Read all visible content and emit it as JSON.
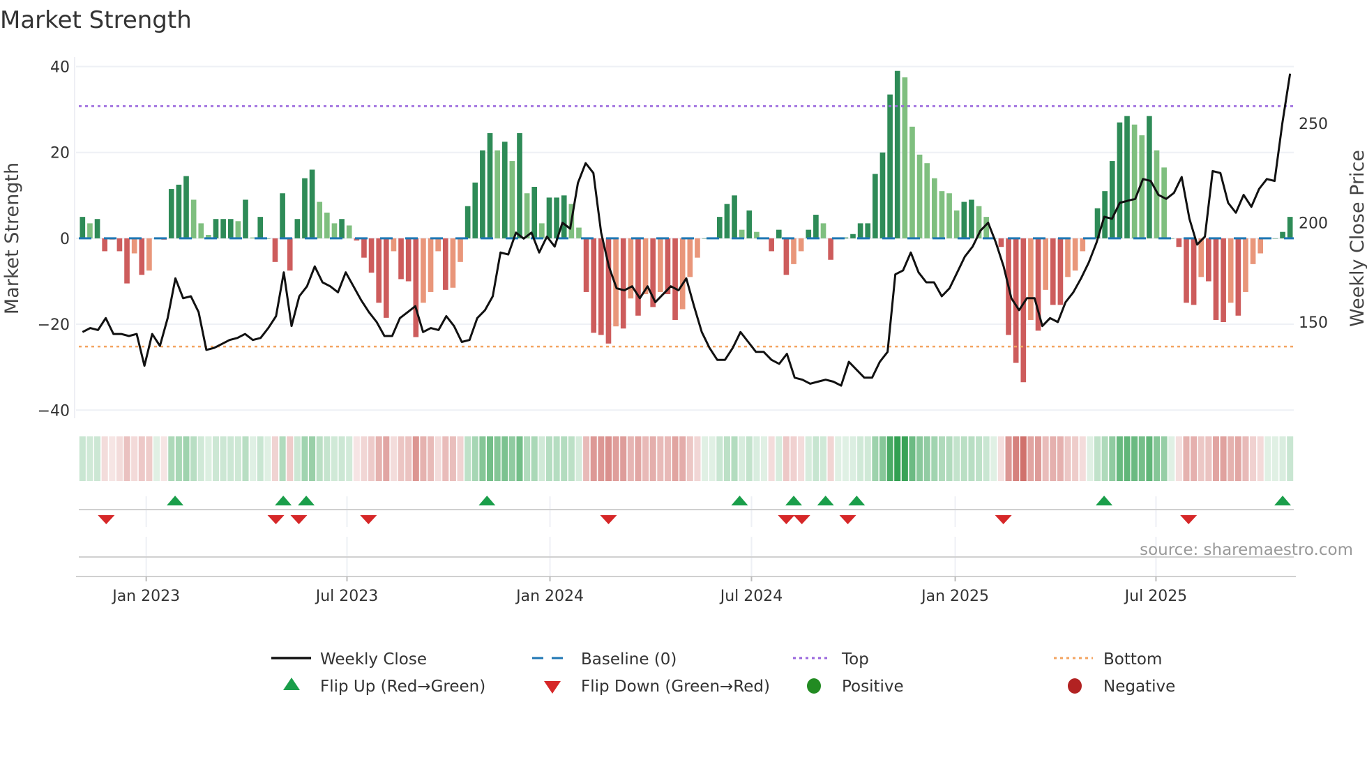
{
  "chart_data": {
    "type": "bar",
    "title": "Market Strength",
    "ylabel": "Market Strength",
    "y2label": "Weekly Close Price",
    "ylim": [
      -41.9,
      42.2
    ],
    "y2lim": [
      101.6,
      283.3
    ],
    "yticks": [
      40,
      20,
      0,
      -20,
      -40
    ],
    "yticklabels": [
      "40",
      "20",
      "0",
      "−20",
      "−40"
    ],
    "y2ticks": [
      150,
      200,
      250
    ],
    "y2ticklabels": [
      "150",
      "200",
      "250"
    ],
    "xticks": [
      {
        "label": "Jan 2023",
        "week_index": 8.6
      },
      {
        "label": "Jul 2023",
        "week_index": 35.7
      },
      {
        "label": "Jan 2024",
        "week_index": 63.1
      },
      {
        "label": "Jul 2024",
        "week_index": 90.3
      },
      {
        "label": "Jan 2025",
        "week_index": 117.8
      },
      {
        "label": "Jul 2025",
        "week_index": 144.9
      }
    ],
    "top_level": 30.8,
    "bottom_level": -25.2,
    "baseline": 0,
    "strength": [
      5,
      3.5,
      4.5,
      -3,
      -0.3,
      -3,
      -10.5,
      -3.5,
      -8.5,
      -7.5,
      0,
      -0.3,
      11.5,
      12.5,
      14.5,
      9,
      3.5,
      0.8,
      4.5,
      4.5,
      4.5,
      4,
      9,
      0.2,
      5,
      0,
      -5.5,
      10.5,
      -7.5,
      4.5,
      14,
      16,
      8.5,
      6,
      3.5,
      4.5,
      3,
      -0.5,
      -4.5,
      -8,
      -15,
      -18.5,
      -3,
      -9.5,
      -10,
      -23,
      -15,
      -12.5,
      -3,
      -12,
      -11.5,
      -5.5,
      7.5,
      13,
      20.5,
      24.5,
      20.5,
      22.5,
      18,
      24.5,
      10.5,
      12,
      3.5,
      9.5,
      9.5,
      10,
      8,
      2.5,
      -12.5,
      -22,
      -22.5,
      -24.5,
      -20.5,
      -21,
      -14,
      -18,
      -13,
      -16,
      -12.5,
      -13,
      -19,
      -16.5,
      -9,
      -4.5,
      0,
      0,
      5,
      8,
      10,
      2,
      6.5,
      1.5,
      0,
      -3,
      2,
      -8.5,
      -6,
      -3,
      2,
      5.5,
      3.5,
      -5,
      0,
      0.2,
      1,
      3.5,
      3.5,
      15,
      20,
      33.5,
      39,
      37.5,
      26,
      19.5,
      17.5,
      14,
      11,
      10.5,
      6.5,
      8.5,
      9,
      7.5,
      5,
      0,
      -2,
      -22.5,
      -29,
      -33.5,
      -19,
      -21.5,
      -12,
      -15.5,
      -15.5,
      -9,
      -7.5,
      -3,
      0,
      7,
      11,
      18,
      27,
      28.5,
      26.5,
      24,
      28.5,
      20.5,
      16.5,
      0,
      -2,
      -15,
      -15.5,
      -9,
      -10,
      -19,
      -19.5,
      -15,
      -18,
      -12.5,
      -6,
      -3.5,
      0,
      0,
      1.5,
      5
    ],
    "weekly_close": [
      145,
      147,
      146,
      152,
      144,
      144,
      143,
      144,
      128,
      144,
      138,
      152,
      172,
      162,
      163,
      155,
      136,
      137,
      139,
      141,
      142,
      144,
      141,
      142,
      147,
      153,
      175,
      148,
      163,
      168,
      178,
      170,
      168,
      165,
      175,
      168,
      161,
      155,
      150,
      143,
      143,
      152,
      155,
      158,
      145,
      147,
      146,
      153,
      148,
      140,
      141,
      152,
      156,
      163,
      185,
      184,
      195,
      192,
      195,
      185,
      193,
      188,
      200,
      197,
      220,
      230,
      225,
      195,
      178,
      167,
      166,
      168,
      162,
      168,
      160,
      164,
      168,
      166,
      172,
      158,
      145,
      137,
      131,
      131,
      137,
      145,
      140,
      135,
      135,
      131,
      129,
      134,
      122,
      121,
      119,
      120,
      121,
      120,
      118,
      130,
      126,
      122,
      122,
      130,
      135,
      174,
      176,
      185,
      175,
      170,
      170,
      163,
      167,
      175,
      183,
      188,
      196,
      200,
      190,
      178,
      162,
      156,
      162,
      162,
      148,
      152,
      150,
      160,
      165,
      172,
      180,
      190,
      203,
      202,
      210,
      211,
      212,
      222,
      221,
      214,
      212,
      215,
      223,
      202,
      189,
      193,
      226,
      225,
      210,
      205,
      214,
      208,
      217,
      222,
      221,
      250,
      275
    ],
    "flip_up_weeks": [
      12.5,
      27.1,
      30.2,
      54.6,
      88.7,
      96.0,
      100.3,
      104.5,
      137.9,
      162.0
    ],
    "flip_down_weeks": [
      3.2,
      26.1,
      29.2,
      38.6,
      71.0,
      95.0,
      97.1,
      103.3,
      124.3,
      149.3
    ],
    "legend_placement": "bottom-center"
  },
  "colors": {
    "pos_strong": "#2e8b57",
    "pos_weak": "#7fbf7f",
    "neg_strong": "#cd5c5c",
    "neg_weak": "#e9967a",
    "baseline": "#1f77b4",
    "top": "#9966dd",
    "bottom": "#f4a460",
    "line": "#111111",
    "flip_up": "#1a9e4a",
    "flip_down": "#d62728",
    "positive": "#228b22",
    "negative": "#b22222"
  },
  "legend": {
    "weekly_close": "Weekly Close",
    "baseline": "Baseline (0)",
    "top": "Top",
    "bottom": "Bottom",
    "flip_up": "Flip Up (Red→Green)",
    "flip_down": "Flip Down (Green→Red)",
    "positive": "Positive",
    "negative": "Negative"
  },
  "source": "source: sharemaestro.com"
}
